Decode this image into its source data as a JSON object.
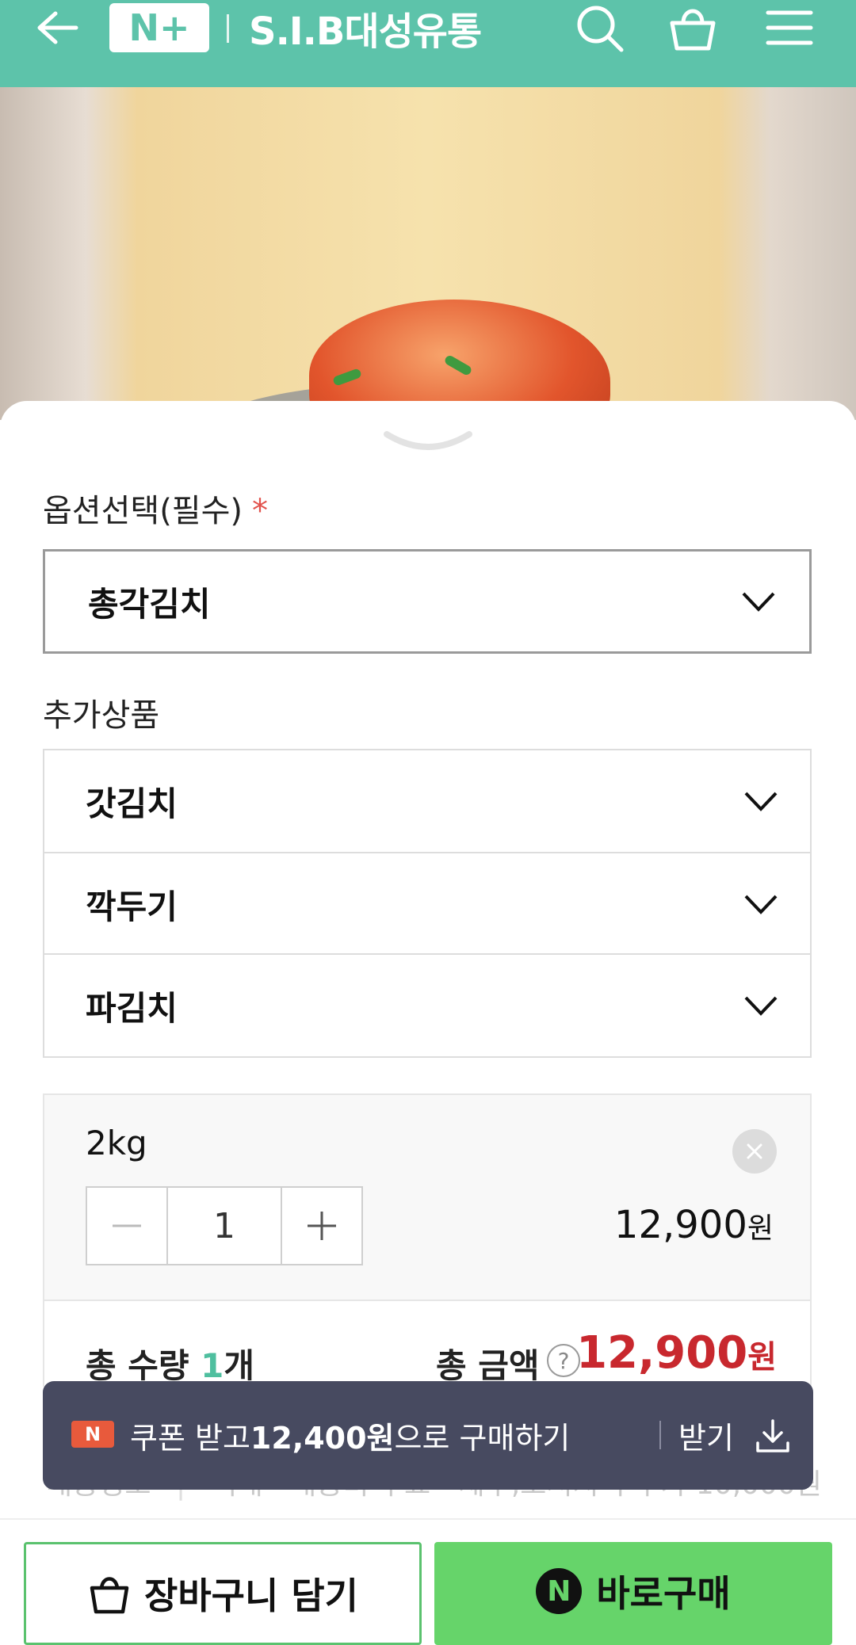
{
  "header": {
    "logo_text": "N+",
    "brand": "S.I.B대성유통",
    "icons": [
      "back-arrow-icon",
      "search-icon",
      "shopping-basket-icon",
      "hamburger-menu-icon"
    ],
    "color": "#5dc3aa"
  },
  "options": {
    "label": "옵션선택(필수)",
    "required_mark": "*",
    "selected": "총각김치"
  },
  "additional": {
    "label": "추가상품",
    "items": [
      "갓김치",
      "깍두기",
      "파김치"
    ]
  },
  "selection": {
    "name": "2kg",
    "quantity": "1",
    "price": "12,900",
    "currency": "원"
  },
  "summary": {
    "qty_label": "총 수량",
    "qty_value": "1",
    "qty_unit": "개",
    "amount_label": "총 금액",
    "help": "?",
    "amount": "12,900",
    "currency": "원",
    "price_color": "#c8282e"
  },
  "shipping": {
    "label": "배송정보",
    "method": "택배 · 배송비 무료",
    "note": "제주,도서지역 추가 10,000원"
  },
  "coupon": {
    "badge": "N",
    "text_before": "쿠폰 받고 ",
    "amount": "12,400원",
    "text_after": "으로 구매하기",
    "action": "받기"
  },
  "buttons": {
    "cart": "장바구니 담기",
    "buy_badge": "N",
    "buy": "바로구매",
    "buy_color": "#66d46a"
  }
}
